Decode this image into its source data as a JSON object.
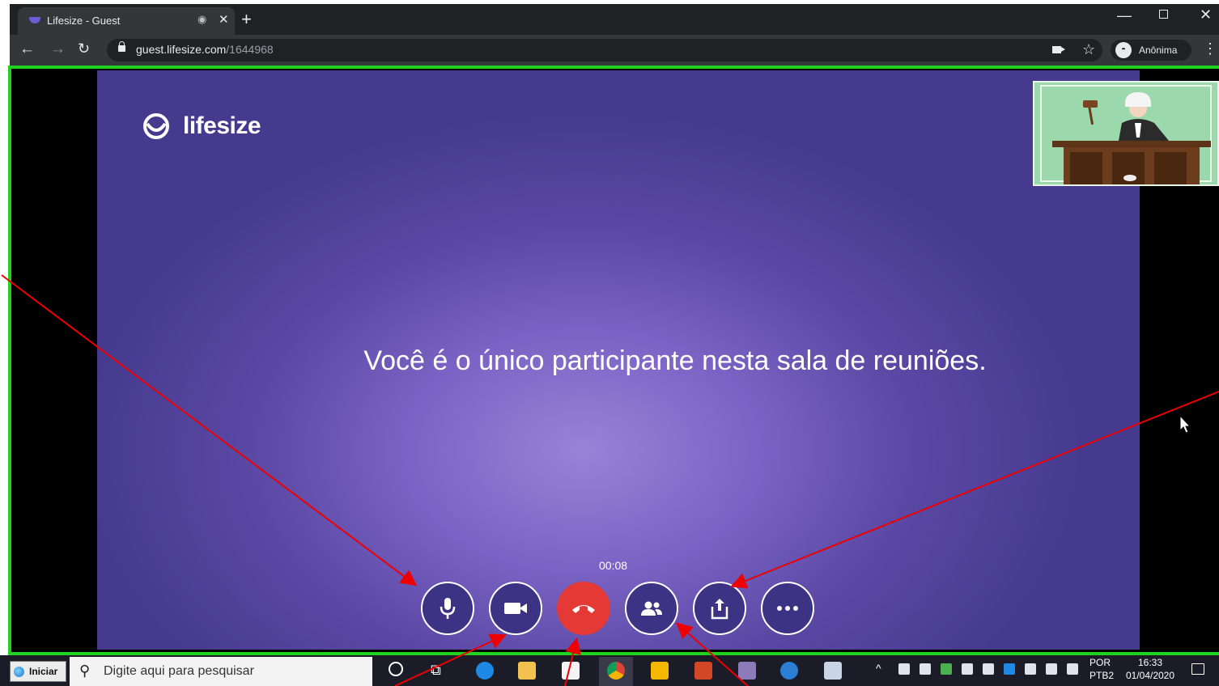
{
  "browser": {
    "tab_title": "Lifesize - Guest",
    "url_host": "guest.lifesize.com",
    "url_path": "/1644968",
    "incognito_label": "Anônima",
    "icons": [
      "back-icon",
      "forward-icon",
      "reload-icon",
      "lock-icon",
      "camera-indicator-icon",
      "star-icon",
      "incognito-icon",
      "kebab-menu-icon"
    ]
  },
  "meeting": {
    "logo_text": "lifesize",
    "message": "Você é o único participante nesta sala de reuniões.",
    "timer": "00:08",
    "controls": [
      {
        "name": "mute-microphone-button",
        "icon": "microphone-icon"
      },
      {
        "name": "toggle-camera-button",
        "icon": "video-camera-icon"
      },
      {
        "name": "end-call-button",
        "icon": "hang-up-icon"
      },
      {
        "name": "participants-button",
        "icon": "participants-icon"
      },
      {
        "name": "share-screen-button",
        "icon": "share-icon"
      },
      {
        "name": "more-options-button",
        "icon": "more-dots-icon"
      }
    ],
    "colors": {
      "accent": "#3c3384",
      "end_call": "#e53935",
      "frame": "#1ed21e"
    }
  },
  "taskbar": {
    "start_label": "Iniciar",
    "search_placeholder": "Digite aqui para pesquisar",
    "lang_top": "POR",
    "lang_bottom": "PTB2",
    "time": "16:33",
    "date": "01/04/2020"
  }
}
